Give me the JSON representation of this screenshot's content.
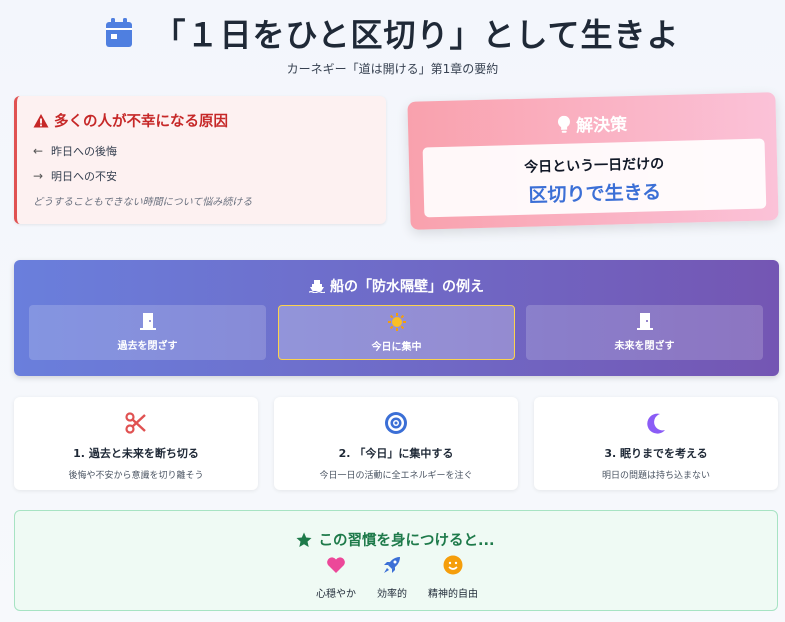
{
  "header": {
    "title": "「１日をひと区切り」として生きよ",
    "subtitle": "カーネギー「道は開ける」第1章の要約",
    "icon": "calendar-icon",
    "accent": "#4f7fe0"
  },
  "cause": {
    "title": "多くの人が不幸になる原因",
    "items": [
      "昨日への後悔",
      "明日への不安"
    ],
    "note": "どうすることもできない時間について悩み続ける",
    "color": "#c62828"
  },
  "solution": {
    "title": "解決策",
    "line1": "今日という一日だけの",
    "line2": "区切りで生きる",
    "highlight": "#3b6fd6"
  },
  "bulkhead": {
    "title": "船の「防水隔壁」の例え",
    "boxes": [
      {
        "label": "過去を閉ざす",
        "icon": "door-icon"
      },
      {
        "label": "今日に集中",
        "icon": "sun-icon"
      },
      {
        "label": "未来を閉ざす",
        "icon": "door-icon"
      }
    ]
  },
  "steps": [
    {
      "title": "1. 過去と未来を断ち切る",
      "desc": "後悔や不安から意識を切り離そう",
      "icon": "scissors-icon",
      "color": "#e05252"
    },
    {
      "title": "2. 「今日」に集中する",
      "desc": "今日一日の活動に全エネルギーを注ぐ",
      "icon": "target-icon",
      "color": "#3b6fd6"
    },
    {
      "title": "3. 眠りまでを考える",
      "desc": "明日の問題は持ち込まない",
      "icon": "moon-icon",
      "color": "#8b5cf6"
    }
  ],
  "benefits": {
    "title": "この習慣を身につけると...",
    "items": [
      {
        "label": "心穏やか",
        "icon": "heart-icon",
        "color": "#ec4899"
      },
      {
        "label": "効率的",
        "icon": "rocket-icon",
        "color": "#3b6fd6"
      },
      {
        "label": "精神的自由",
        "icon": "smile-icon",
        "color": "#f59e0b"
      }
    ]
  }
}
